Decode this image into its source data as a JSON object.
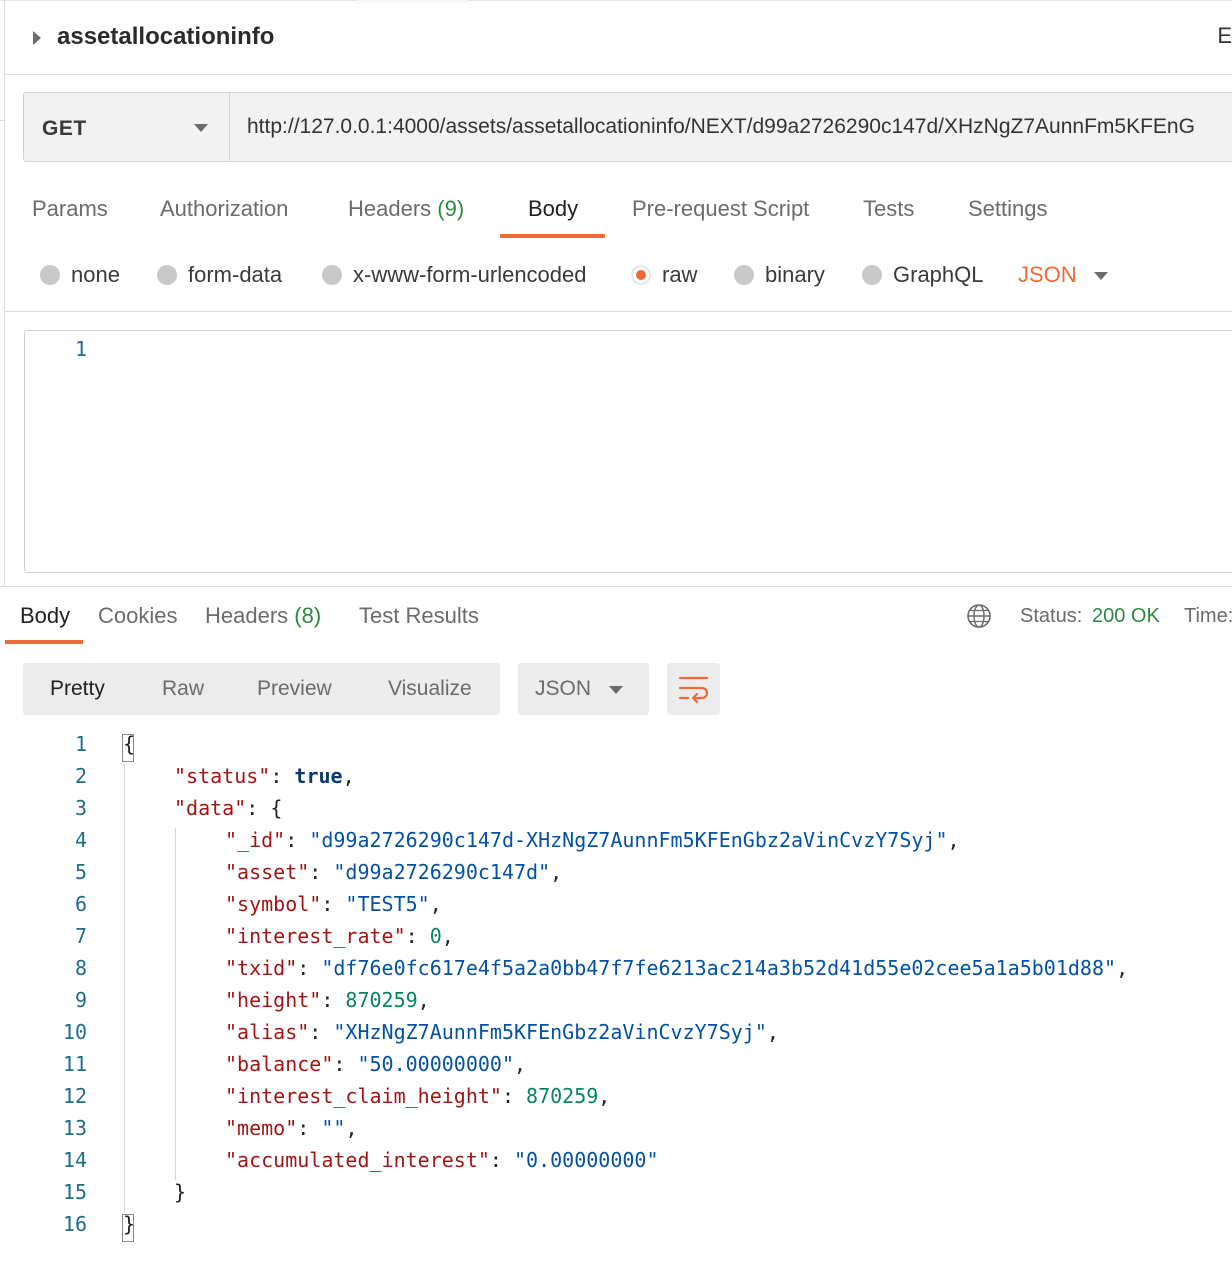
{
  "header": {
    "title": "assetallocationinfo",
    "edge_label": "E"
  },
  "request": {
    "method": "GET",
    "url": "http://127.0.0.1:4000/assets/assetallocationinfo/NEXT/d99a2726290c147d/XHzNgZ7AunnFm5KFEnG"
  },
  "request_tabs": [
    {
      "label": "Params"
    },
    {
      "label": "Authorization"
    },
    {
      "label": "Headers",
      "count": "(9)"
    },
    {
      "label": "Body",
      "active": true
    },
    {
      "label": "Pre-request Script"
    },
    {
      "label": "Tests"
    },
    {
      "label": "Settings"
    }
  ],
  "body_types": [
    {
      "label": "none"
    },
    {
      "label": "form-data"
    },
    {
      "label": "x-www-form-urlencoded"
    },
    {
      "label": "raw",
      "selected": true
    },
    {
      "label": "binary"
    },
    {
      "label": "GraphQL"
    }
  ],
  "body_format": "JSON",
  "request_editor": {
    "line_numbers": [
      "1"
    ]
  },
  "response_tabs": [
    {
      "label": "Body",
      "active": true
    },
    {
      "label": "Cookies"
    },
    {
      "label": "Headers",
      "count": "(8)"
    },
    {
      "label": "Test Results"
    }
  ],
  "response_status": {
    "label": "Status:",
    "value": "200 OK",
    "time_label": "Time:"
  },
  "response_views": [
    {
      "label": "Pretty",
      "active": true
    },
    {
      "label": "Raw"
    },
    {
      "label": "Preview"
    },
    {
      "label": "Visualize"
    }
  ],
  "response_format": "JSON",
  "colors": {
    "accent": "#ee6a3a",
    "success": "#2b8a3e",
    "key": "#a31515",
    "string": "#0451a5",
    "number": "#098658"
  },
  "response_code": [
    {
      "ln": "1",
      "indent": 0,
      "tokens": [
        {
          "t": "p",
          "v": "{"
        }
      ]
    },
    {
      "ln": "2",
      "indent": 1,
      "tokens": [
        {
          "t": "k",
          "v": "\"status\""
        },
        {
          "t": "p",
          "v": ": "
        },
        {
          "t": "b",
          "v": "true"
        },
        {
          "t": "p",
          "v": ","
        }
      ]
    },
    {
      "ln": "3",
      "indent": 1,
      "tokens": [
        {
          "t": "k",
          "v": "\"data\""
        },
        {
          "t": "p",
          "v": ": {"
        }
      ]
    },
    {
      "ln": "4",
      "indent": 2,
      "tokens": [
        {
          "t": "k",
          "v": "\"_id\""
        },
        {
          "t": "p",
          "v": ": "
        },
        {
          "t": "s",
          "v": "\"d99a2726290c147d-XHzNgZ7AunnFm5KFEnGbz2aVinCvzY7Syj\""
        },
        {
          "t": "p",
          "v": ","
        }
      ]
    },
    {
      "ln": "5",
      "indent": 2,
      "tokens": [
        {
          "t": "k",
          "v": "\"asset\""
        },
        {
          "t": "p",
          "v": ": "
        },
        {
          "t": "s",
          "v": "\"d99a2726290c147d\""
        },
        {
          "t": "p",
          "v": ","
        }
      ]
    },
    {
      "ln": "6",
      "indent": 2,
      "tokens": [
        {
          "t": "k",
          "v": "\"symbol\""
        },
        {
          "t": "p",
          "v": ": "
        },
        {
          "t": "s",
          "v": "\"TEST5\""
        },
        {
          "t": "p",
          "v": ","
        }
      ]
    },
    {
      "ln": "7",
      "indent": 2,
      "tokens": [
        {
          "t": "k",
          "v": "\"interest_rate\""
        },
        {
          "t": "p",
          "v": ": "
        },
        {
          "t": "n",
          "v": "0"
        },
        {
          "t": "p",
          "v": ","
        }
      ]
    },
    {
      "ln": "8",
      "indent": 2,
      "tokens": [
        {
          "t": "k",
          "v": "\"txid\""
        },
        {
          "t": "p",
          "v": ": "
        },
        {
          "t": "s",
          "v": "\"df76e0fc617e4f5a2a0bb47f7fe6213ac214a3b52d41d55e02cee5a1a5b01d88\""
        },
        {
          "t": "p",
          "v": ","
        }
      ]
    },
    {
      "ln": "9",
      "indent": 2,
      "tokens": [
        {
          "t": "k",
          "v": "\"height\""
        },
        {
          "t": "p",
          "v": ": "
        },
        {
          "t": "n",
          "v": "870259"
        },
        {
          "t": "p",
          "v": ","
        }
      ]
    },
    {
      "ln": "10",
      "indent": 2,
      "tokens": [
        {
          "t": "k",
          "v": "\"alias\""
        },
        {
          "t": "p",
          "v": ": "
        },
        {
          "t": "s",
          "v": "\"XHzNgZ7AunnFm5KFEnGbz2aVinCvzY7Syj\""
        },
        {
          "t": "p",
          "v": ","
        }
      ]
    },
    {
      "ln": "11",
      "indent": 2,
      "tokens": [
        {
          "t": "k",
          "v": "\"balance\""
        },
        {
          "t": "p",
          "v": ": "
        },
        {
          "t": "s",
          "v": "\"50.00000000\""
        },
        {
          "t": "p",
          "v": ","
        }
      ]
    },
    {
      "ln": "12",
      "indent": 2,
      "tokens": [
        {
          "t": "k",
          "v": "\"interest_claim_height\""
        },
        {
          "t": "p",
          "v": ": "
        },
        {
          "t": "n",
          "v": "870259"
        },
        {
          "t": "p",
          "v": ","
        }
      ]
    },
    {
      "ln": "13",
      "indent": 2,
      "tokens": [
        {
          "t": "k",
          "v": "\"memo\""
        },
        {
          "t": "p",
          "v": ": "
        },
        {
          "t": "s",
          "v": "\"\""
        },
        {
          "t": "p",
          "v": ","
        }
      ]
    },
    {
      "ln": "14",
      "indent": 2,
      "tokens": [
        {
          "t": "k",
          "v": "\"accumulated_interest\""
        },
        {
          "t": "p",
          "v": ": "
        },
        {
          "t": "s",
          "v": "\"0.00000000\""
        }
      ]
    },
    {
      "ln": "15",
      "indent": 1,
      "tokens": [
        {
          "t": "p",
          "v": "}"
        }
      ]
    },
    {
      "ln": "16",
      "indent": 0,
      "tokens": [
        {
          "t": "p",
          "v": "}"
        }
      ]
    }
  ]
}
